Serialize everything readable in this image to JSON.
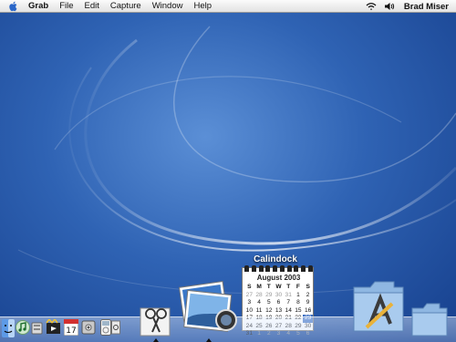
{
  "menubar": {
    "app_name": "Grab",
    "items": [
      "File",
      "Edit",
      "Capture",
      "Window",
      "Help"
    ],
    "user": "Brad Miser",
    "icons": [
      "apple-icon",
      "wifi-icon",
      "volume-icon"
    ]
  },
  "calindock": {
    "label": "Calindock",
    "month_title": "August 2003",
    "days_of_week": [
      "S",
      "M",
      "T",
      "W",
      "T",
      "F",
      "S"
    ],
    "rows": [
      [
        "27",
        "28",
        "29",
        "30",
        "31",
        "1",
        "2"
      ],
      [
        "3",
        "4",
        "5",
        "6",
        "7",
        "8",
        "9"
      ],
      [
        "10",
        "11",
        "12",
        "13",
        "14",
        "15",
        "16"
      ],
      [
        "17",
        "18",
        "19",
        "20",
        "21",
        "22",
        "23"
      ],
      [
        "24",
        "25",
        "26",
        "27",
        "28",
        "29",
        "30"
      ],
      [
        "31",
        "1",
        "2",
        "3",
        "4",
        "5",
        "6"
      ]
    ],
    "today": "23"
  },
  "dock": {
    "items": [
      "finder",
      "itunes",
      "preferences",
      "imovie",
      "ical",
      "system-preferences",
      "ipod",
      "grab",
      "iphoto",
      "applications-folder",
      "documents-folder"
    ]
  },
  "colors": {
    "desktop": "#2f63b4",
    "today_highlight": "#3d6fc2"
  }
}
